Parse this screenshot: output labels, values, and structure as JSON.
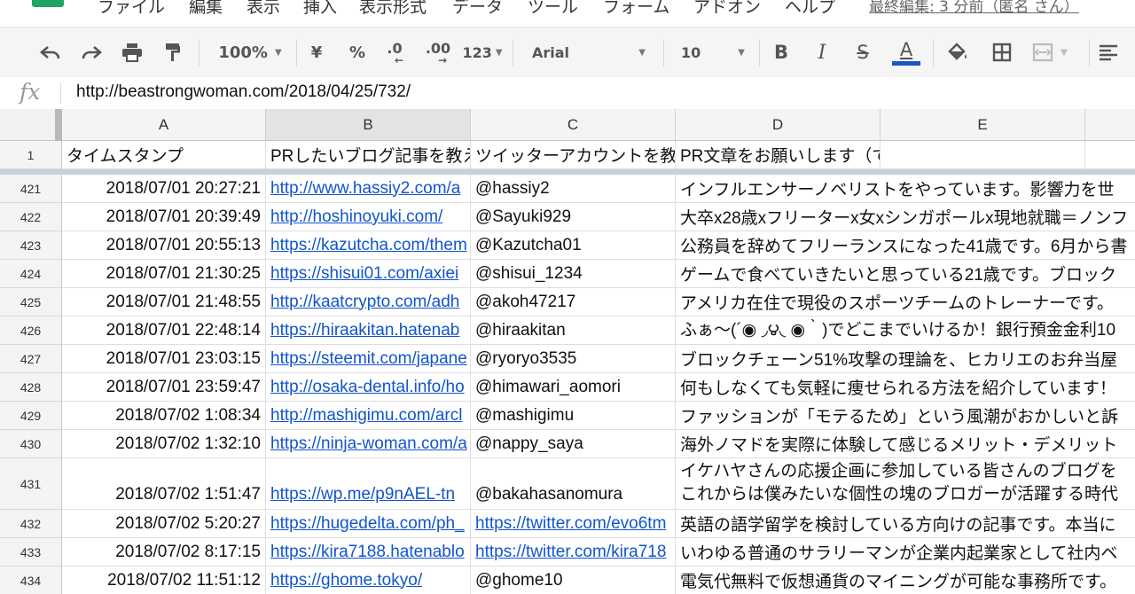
{
  "menu": [
    "ファイル",
    "編集",
    "表示",
    "挿入",
    "表示形式",
    "データ",
    "ツール",
    "フォーム",
    "アドオン",
    "ヘルプ"
  ],
  "last_edit": "最終編集: 3 分前（匿名 さん）",
  "toolbar": {
    "zoom": "100%",
    "currency": "¥",
    "percent": "%",
    "dec_decrease": ".0",
    "dec_increase": ".00",
    "more_formats": "123",
    "font": "Arial",
    "font_size": "10",
    "bold": "B",
    "italic": "I",
    "strikethrough": "S",
    "text_color_label": "A",
    "text_color": "#1a56c4"
  },
  "formula": {
    "fx_label": "fx",
    "value": "http://beastrongwoman.com/2018/04/25/732/"
  },
  "sheet": {
    "columns": [
      "A",
      "B",
      "C",
      "D",
      "E"
    ],
    "selected_column": "B",
    "header_row": {
      "num": "1",
      "cells": [
        "タイムスタンプ",
        "PRしたいブログ記事を教えてください",
        "ツイッターアカウントを教えてください",
        "PR文章をお願いします（できれば簡潔に）",
        ""
      ]
    },
    "rows": [
      {
        "num": "421",
        "a": "2018/07/01 20:27:21",
        "b": "http://www.hassiy2.com/a",
        "c": "@hassiy2",
        "c_link": false,
        "d": "インフルエンサーノベリストをやっています。影響力を世"
      },
      {
        "num": "422",
        "a": "2018/07/01 20:39:49",
        "b": "http://hoshinoyuki.com/",
        "c": "@Sayuki929",
        "c_link": false,
        "d": "大卒x28歳xフリーターx女xシンガポールx現地就職＝ノンフ"
      },
      {
        "num": "423",
        "a": "2018/07/01 20:55:13",
        "b": "https://kazutcha.com/them",
        "c": "@Kazutcha01",
        "c_link": false,
        "d": "公務員を辞めてフリーランスになった41歳です。6月から書"
      },
      {
        "num": "424",
        "a": "2018/07/01 21:30:25",
        "b": "https://shisui01.com/axiei",
        "c": "@shisui_1234",
        "c_link": false,
        "d": "ゲームで食べていきたいと思っている21歳です。ブロック"
      },
      {
        "num": "425",
        "a": "2018/07/01 21:48:55",
        "b": "http://kaatcrypto.com/adh",
        "c": "@akoh47217",
        "c_link": false,
        "d": "アメリカ在住で現役のスポーツチームのトレーナーです。"
      },
      {
        "num": "426",
        "a": "2018/07/01 22:48:14",
        "b": "https://hiraakitan.hatenab",
        "c": "@hiraakitan",
        "c_link": false,
        "d": "ふぁ〜(´◉ ◞౪◟ ◉｀)でどこまでいけるか！銀行預金金利10"
      },
      {
        "num": "427",
        "a": "2018/07/01 23:03:15",
        "b": "https://steemit.com/japane",
        "c": "@ryoryo3535",
        "c_link": false,
        "d": "ブロックチェーン51%攻撃の理論を、ヒカリエのお弁当屋"
      },
      {
        "num": "428",
        "a": "2018/07/01 23:59:47",
        "b": "http://osaka-dental.info/ho",
        "c": "@himawari_aomori",
        "c_link": false,
        "d": "何もしなくても気軽に痩せられる方法を紹介しています！"
      },
      {
        "num": "429",
        "a": "2018/07/02 1:08:34",
        "b": "http://mashigimu.com/arcl",
        "c": "@mashigimu",
        "c_link": false,
        "d": "ファッションが「モテるため」という風潮がおかしいと訴"
      },
      {
        "num": "430",
        "a": "2018/07/02 1:32:10",
        "b": "https://ninja-woman.com/a",
        "c": "@nappy_saya",
        "c_link": false,
        "d": "海外ノマドを実際に体験して感じるメリット・デメリット"
      },
      {
        "num": "431",
        "a": "2018/07/02 1:51:47",
        "b": "https://wp.me/p9nAEL-tn",
        "c": "@bakahasanomura",
        "c_link": false,
        "d": "イケハヤさんの応援企画に参加している皆さんのブログを\nこれからは僕みたいな個性の塊のブロガーが活躍する時代"
      },
      {
        "num": "432",
        "a": "2018/07/02 5:20:27",
        "b": "https://hugedelta.com/ph_",
        "c": "https://twitter.com/evo6tm",
        "c_link": true,
        "d": "英語の語学留学を検討している方向けの記事です。本当に"
      },
      {
        "num": "433",
        "a": "2018/07/02 8:17:15",
        "b": "https://kira7188.hatenablo",
        "c": "https://twitter.com/kira718",
        "c_link": true,
        "d": "いわゆる普通のサラリーマンが企業内起業家として社内ベ"
      },
      {
        "num": "434",
        "a": "2018/07/02 11:51:12",
        "b": "https://ghome.tokyo/",
        "c": "@ghome10",
        "c_link": false,
        "d": "電気代無料で仮想通貨のマイニングが可能な事務所です。"
      }
    ]
  }
}
